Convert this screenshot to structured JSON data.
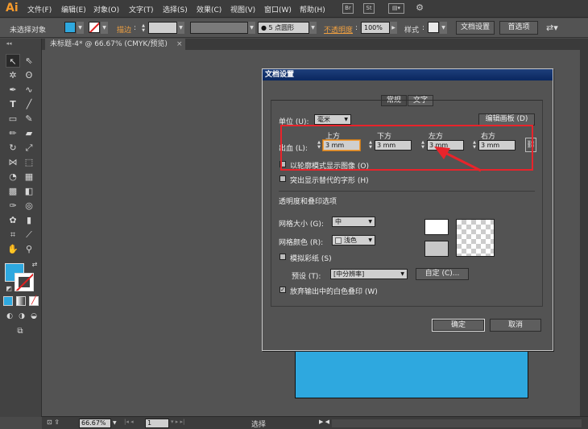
{
  "app": {
    "logo": "Ai",
    "menu": [
      "文件(F)",
      "编辑(E)",
      "对象(O)",
      "文字(T)",
      "选择(S)",
      "效果(C)",
      "视图(V)",
      "窗口(W)",
      "帮助(H)"
    ],
    "menu_icons": [
      "Br",
      "St"
    ]
  },
  "control_bar": {
    "selection_label": "未选择对象",
    "stroke_label": "描边",
    "brush_value": "5 点圆形",
    "opacity_label": "不透明度",
    "opacity_value": "100%",
    "style_label": "样式",
    "doc_setup_button": "文档设置",
    "preferences_button": "首选项",
    "fill_color": "#2ea8df"
  },
  "document_tab": {
    "title": "未标题-4* @ 66.67% (CMYK/预览)",
    "close": "×"
  },
  "status_bar": {
    "zoom": "66.67%",
    "artboard": "1",
    "tool": "选择"
  },
  "dialog": {
    "title": "文档设置",
    "tabs": [
      "常规",
      "文字"
    ],
    "units_label": "单位 (U):",
    "units_value": "毫米",
    "edit_artboards_button": "编辑画板 (D)",
    "bleed_label": "出血 (L):",
    "bleed_columns": [
      {
        "label": "上方",
        "value": "3 mm"
      },
      {
        "label": "下方",
        "value": "3 mm"
      },
      {
        "label": "左方",
        "value": "3 mm"
      },
      {
        "label": "右方",
        "value": "3 mm"
      }
    ],
    "outline_label": "以轮廓模式显示图像 (O)",
    "glyph_label": "突出显示替代的字形 (H)",
    "transparency_section": "透明度和叠印选项",
    "grid_size_label": "网格大小 (G):",
    "grid_size_value": "中",
    "grid_color_label": "网格颜色 (R):",
    "grid_color_value": "浅色",
    "simulate_paper_label": "模拟彩纸 (S)",
    "preset_label": "预设 (T):",
    "preset_value": "[中分辨率]",
    "custom_button": "自定 (C)...",
    "discard_white_label": "放弃输出中的白色叠印 (W)",
    "ok_button": "确定",
    "cancel_button": "取消",
    "checkmark": "✓"
  }
}
